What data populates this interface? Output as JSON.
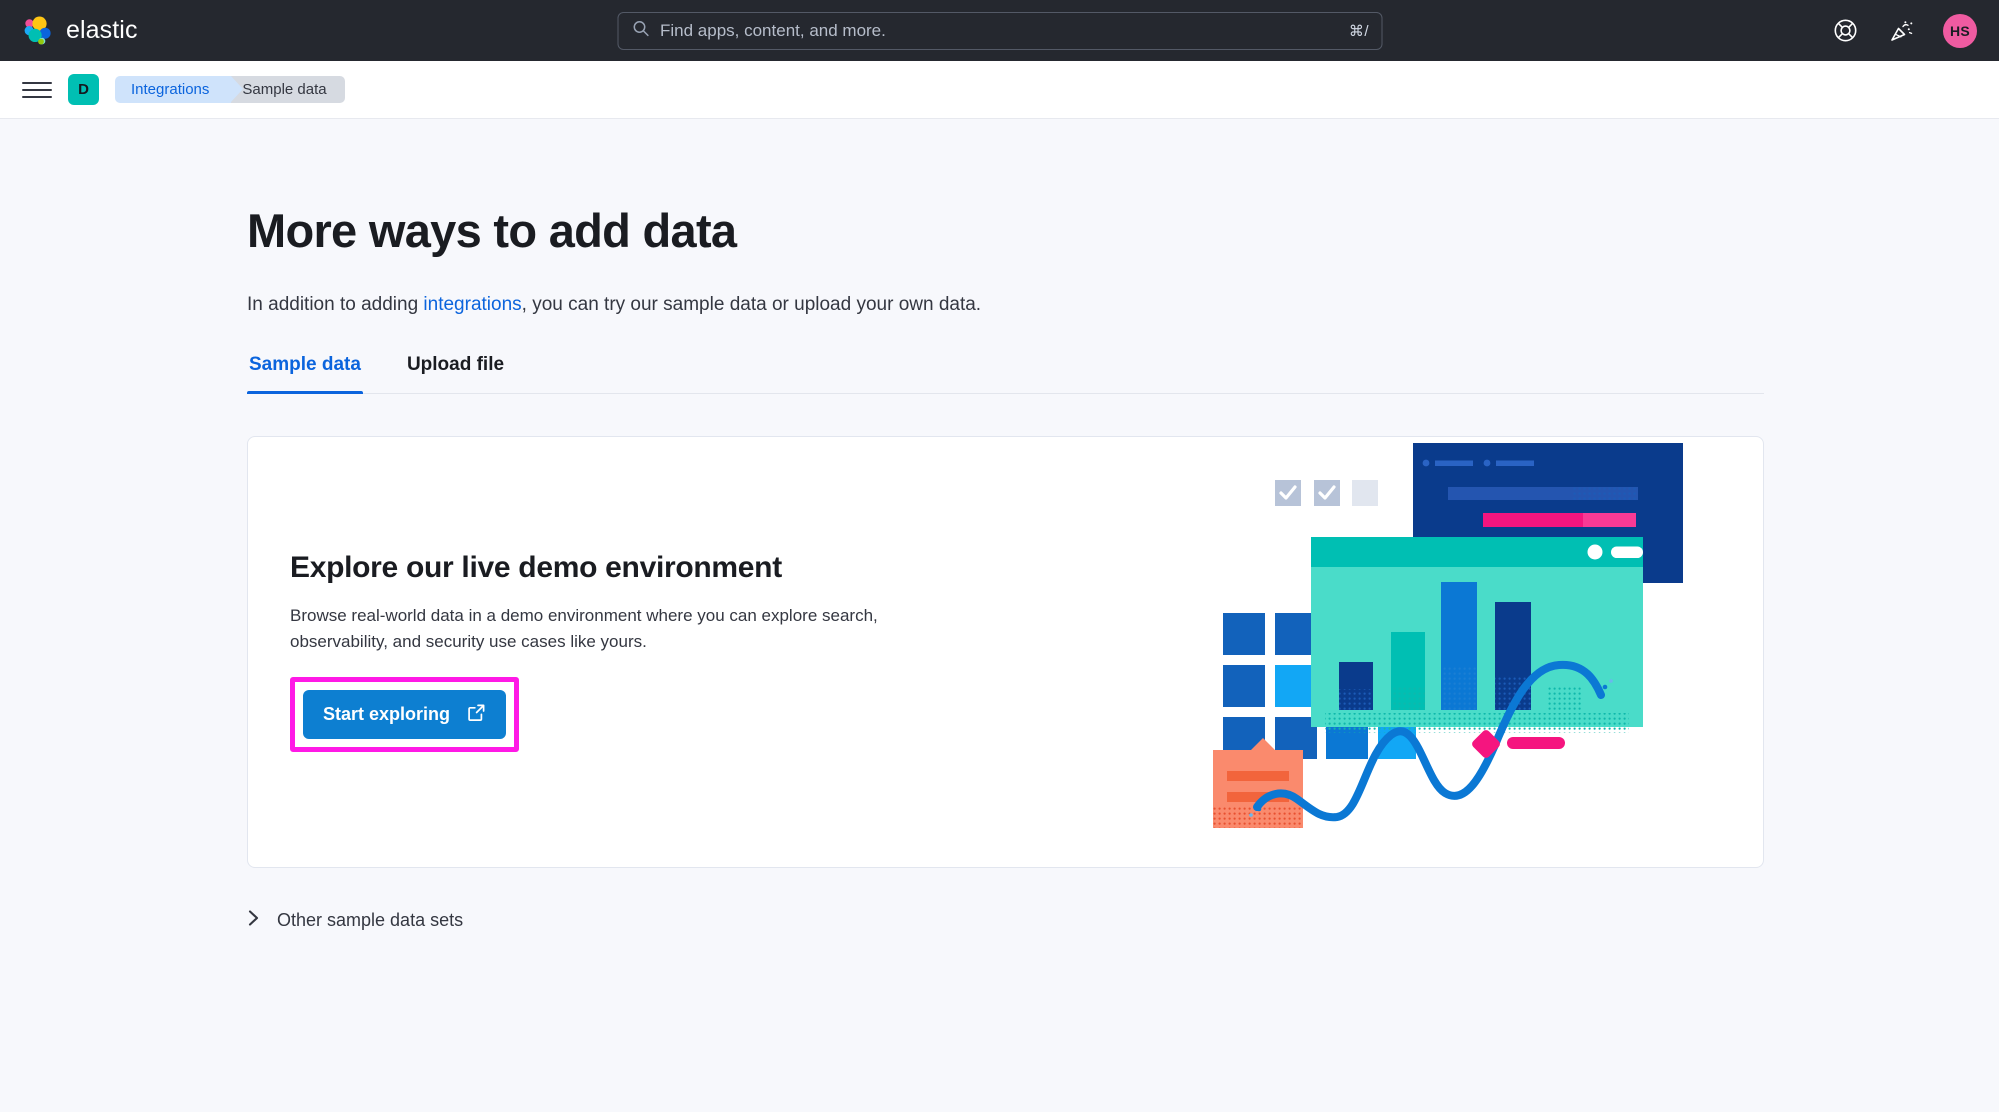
{
  "topbar": {
    "brand_name": "elastic",
    "logo_icon": "elastic-logo-icon",
    "search": {
      "placeholder": "Find apps, content, and more.",
      "value": "",
      "icon": "search-icon",
      "shortcut": "⌘/"
    },
    "help_icon": "lifebuoy-help-icon",
    "whats_new_icon": "party-popper-icon",
    "avatar_initials": "HS",
    "avatar_color": "#ef5ba1"
  },
  "breadcrumb_bar": {
    "menu_icon": "hamburger-menu-icon",
    "space_badge": "D",
    "space_badge_color": "#00bfb3",
    "crumbs": [
      {
        "label": "Integrations"
      },
      {
        "label": "Sample data"
      }
    ]
  },
  "main": {
    "title": "More ways to add data",
    "subtitle_before": "In addition to adding ",
    "subtitle_link": "integrations",
    "subtitle_after": ", you can try our sample data or upload your own data.",
    "tabs": [
      {
        "label": "Sample data",
        "active": true
      },
      {
        "label": "Upload file",
        "active": false
      }
    ],
    "card": {
      "heading": "Explore our live demo environment",
      "body": "Browse real-world data in a demo environment where you can explore search, observability, and security use cases like yours.",
      "cta_label": "Start exploring",
      "cta_icon": "external-link-icon",
      "cta_color": "#0d7fd1",
      "highlight_color": "#ff19e6",
      "art_icon": "data-dashboard-illustration"
    },
    "accordion": {
      "label": "Other sample data sets",
      "icon": "chevron-right-icon",
      "expanded": false
    }
  }
}
